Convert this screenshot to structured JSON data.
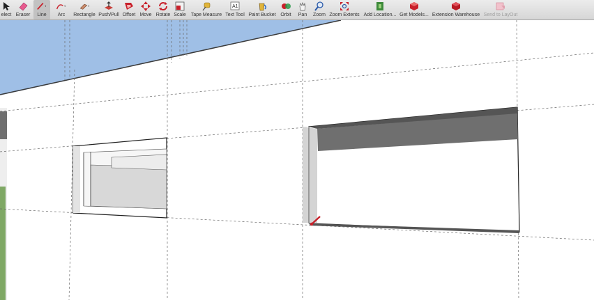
{
  "toolbar": {
    "tools": [
      {
        "label": "elect"
      },
      {
        "label": "Eraser"
      },
      {
        "label": "Line"
      },
      {
        "label": "Arc"
      },
      {
        "label": "Rectangle"
      },
      {
        "label": "Push/Pull"
      },
      {
        "label": "Offset"
      },
      {
        "label": "Move"
      },
      {
        "label": "Rotate"
      },
      {
        "label": "Scale"
      },
      {
        "label": "Tape Measure"
      },
      {
        "label": "Text Tool"
      },
      {
        "label": "Paint Bucket"
      },
      {
        "label": "Orbit"
      },
      {
        "label": "Pan"
      },
      {
        "label": "Zoom"
      },
      {
        "label": "Zoom Extents"
      },
      {
        "label": "Add Location..."
      },
      {
        "label": "Get Models..."
      },
      {
        "label": "Extension Warehouse"
      },
      {
        "label": "Send to LayOut"
      }
    ],
    "active_tool": "Line",
    "text_tool_glyph": "A1"
  },
  "colors": {
    "sky": "#9fbfe6",
    "wall": "#ffffff",
    "reveal_dark": "#6f6f6f",
    "reveal_light": "#d4d4d4",
    "ground": "#7fa865",
    "cursor": "#c8202a"
  }
}
